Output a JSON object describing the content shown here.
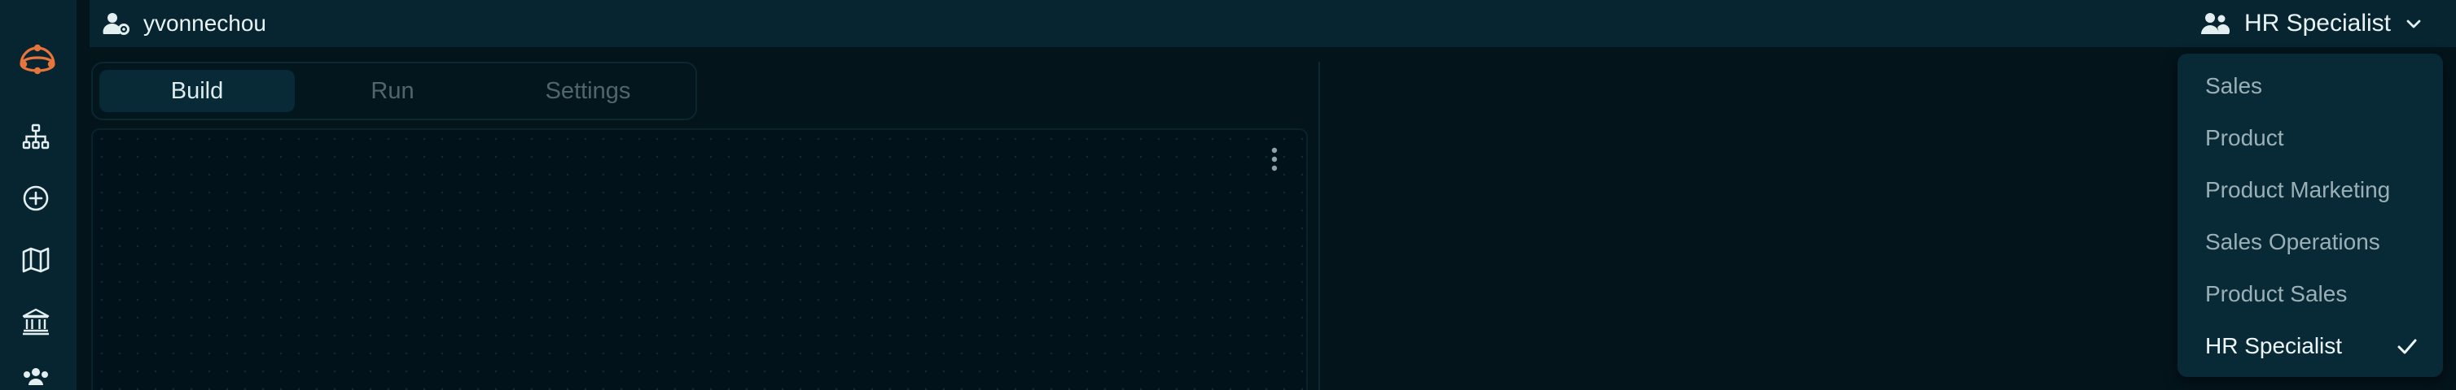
{
  "user": {
    "name": "yvonnechou",
    "icon": "user-gear-icon"
  },
  "role_selector": {
    "selected": "HR Specialist",
    "icon": "users-icon"
  },
  "rail": {
    "logo": "app-logo-icon",
    "items": [
      {
        "name": "org-chart-icon"
      },
      {
        "name": "plus-circle-icon"
      },
      {
        "name": "map-icon"
      },
      {
        "name": "bank-icon"
      },
      {
        "name": "team-icon"
      }
    ]
  },
  "tabs": [
    {
      "label": "Build",
      "active": true
    },
    {
      "label": "Run",
      "active": false
    },
    {
      "label": "Settings",
      "active": false
    }
  ],
  "dropdown": {
    "options": [
      {
        "label": "Sales",
        "selected": false
      },
      {
        "label": "Product",
        "selected": false
      },
      {
        "label": "Product Marketing",
        "selected": false
      },
      {
        "label": "Sales Operations",
        "selected": false
      },
      {
        "label": "Product Sales",
        "selected": false
      },
      {
        "label": "HR Specialist",
        "selected": true
      }
    ]
  },
  "colors": {
    "background": "#03141b",
    "panel": "#062530",
    "dropdown": "#082a36",
    "accent": "#e8743b",
    "text": "#e9f2f4",
    "muted": "#9bb0b6"
  }
}
